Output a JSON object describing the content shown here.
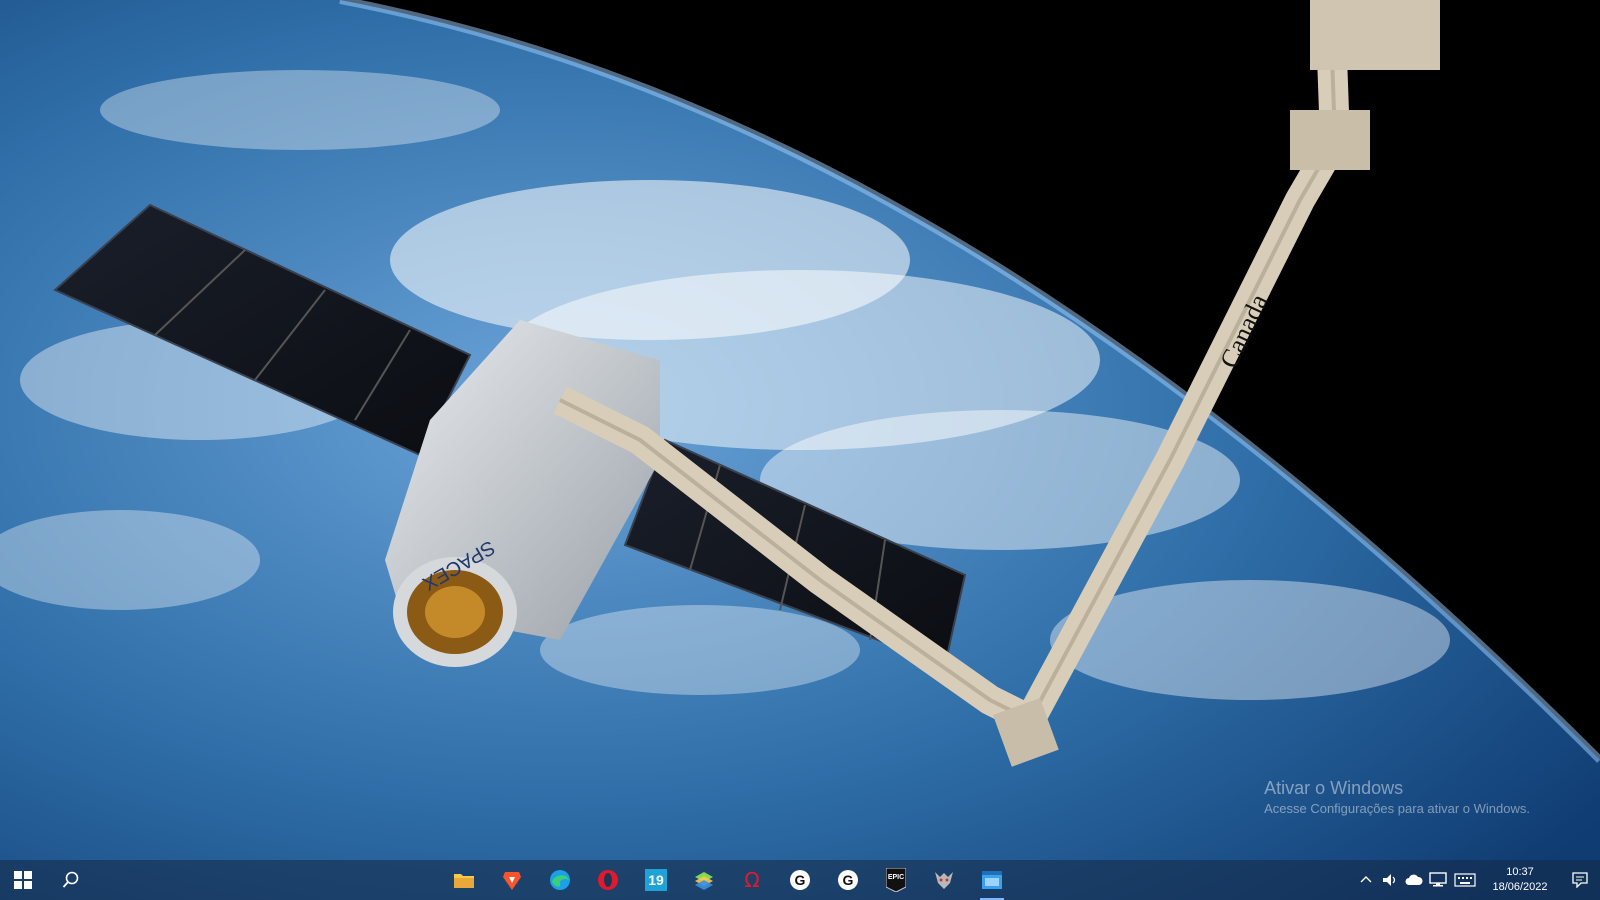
{
  "watermark": {
    "title": "Ativar o Windows",
    "subtitle": "Acesse Configurações para ativar o Windows."
  },
  "taskbar": {
    "apps": [
      {
        "icon": "file-explorer-icon",
        "name": "file-explorer"
      },
      {
        "icon": "brave-icon",
        "name": "brave"
      },
      {
        "icon": "edge-icon",
        "name": "edge"
      },
      {
        "icon": "opera-icon",
        "name": "opera"
      },
      {
        "icon": "calendar-19-icon",
        "name": "app-19",
        "label": "19"
      },
      {
        "icon": "bluestacks-icon",
        "name": "bluestacks"
      },
      {
        "icon": "omega-icon",
        "name": "omega-app"
      },
      {
        "icon": "logitech-g-icon",
        "name": "logitech-g-hub"
      },
      {
        "icon": "logitech-g-icon",
        "name": "logitech-g-hub-2"
      },
      {
        "icon": "epic-games-icon",
        "name": "epic-games",
        "label": "EPIC"
      },
      {
        "icon": "witcher-icon",
        "name": "witcher"
      },
      {
        "icon": "window-app-icon",
        "name": "active-window"
      }
    ],
    "clock": {
      "time": "10:37",
      "date": "18/06/2022"
    },
    "colors": {
      "taskbar": "#1d3556",
      "accent": "#7fb6ff"
    }
  },
  "wallpaper": {
    "arm_label": "Canada",
    "capsule_label": "SPACEX"
  }
}
